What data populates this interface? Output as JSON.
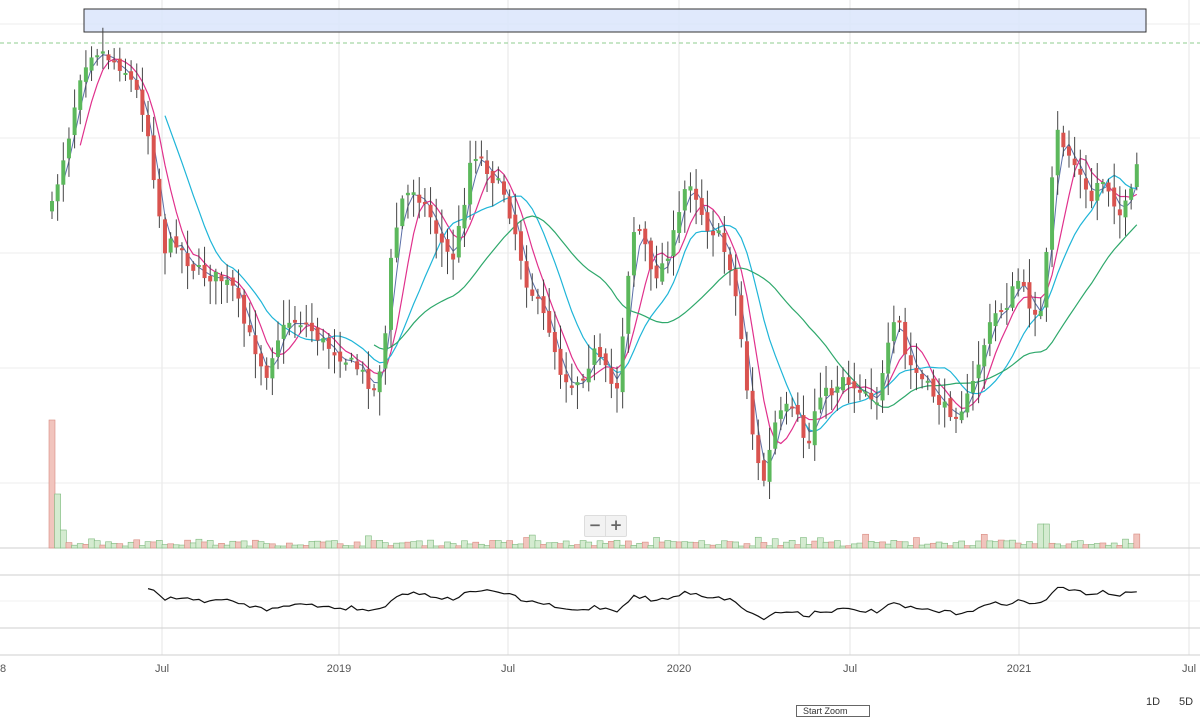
{
  "chart_data": {
    "type": "candlestick",
    "title": "",
    "xlabel": "",
    "ylabel": "",
    "x_axis_ticks": [
      "Jul",
      "2019",
      "Jul",
      "2020",
      "Jul",
      "2021",
      "Jul"
    ],
    "x_axis_partial_left_label": "8",
    "time_range": [
      "2018-04",
      "2021-07"
    ],
    "interval": "weekly",
    "y_axis_labels_visible": false,
    "grid": true,
    "panels": [
      "price",
      "volume",
      "oscillator"
    ],
    "overlays": [
      "price-band",
      "dashed-resistance-line"
    ],
    "price_band": {
      "fill": "#dbe5fb",
      "stroke": "#333333"
    },
    "resistance_line_color": "#8fce8f",
    "colors": {
      "up": "#5cb85c",
      "down": "#d9534f",
      "ma_fast": "#5b6fa8",
      "ma_mid": "#e0318c",
      "ma_slow": "#1fb5d8",
      "ma_long": "#2ea86b"
    },
    "series": [
      {
        "name": "",
        "style": "thin-blue-ma",
        "values": []
      },
      {
        "name": "",
        "style": "magenta-ma",
        "values": []
      },
      {
        "name": "",
        "style": "cyan-ma",
        "values": []
      },
      {
        "name": "",
        "style": "green-ma",
        "values": []
      }
    ],
    "candles": [
      {
        "o": 0,
        "h": 0,
        "l": 0,
        "c": 0
      }
    ]
  },
  "controls": {
    "zoom_out": "−",
    "zoom_in": "+",
    "ranges": [
      "1D",
      "5D"
    ],
    "partial_box_text": "Start Zoom"
  }
}
